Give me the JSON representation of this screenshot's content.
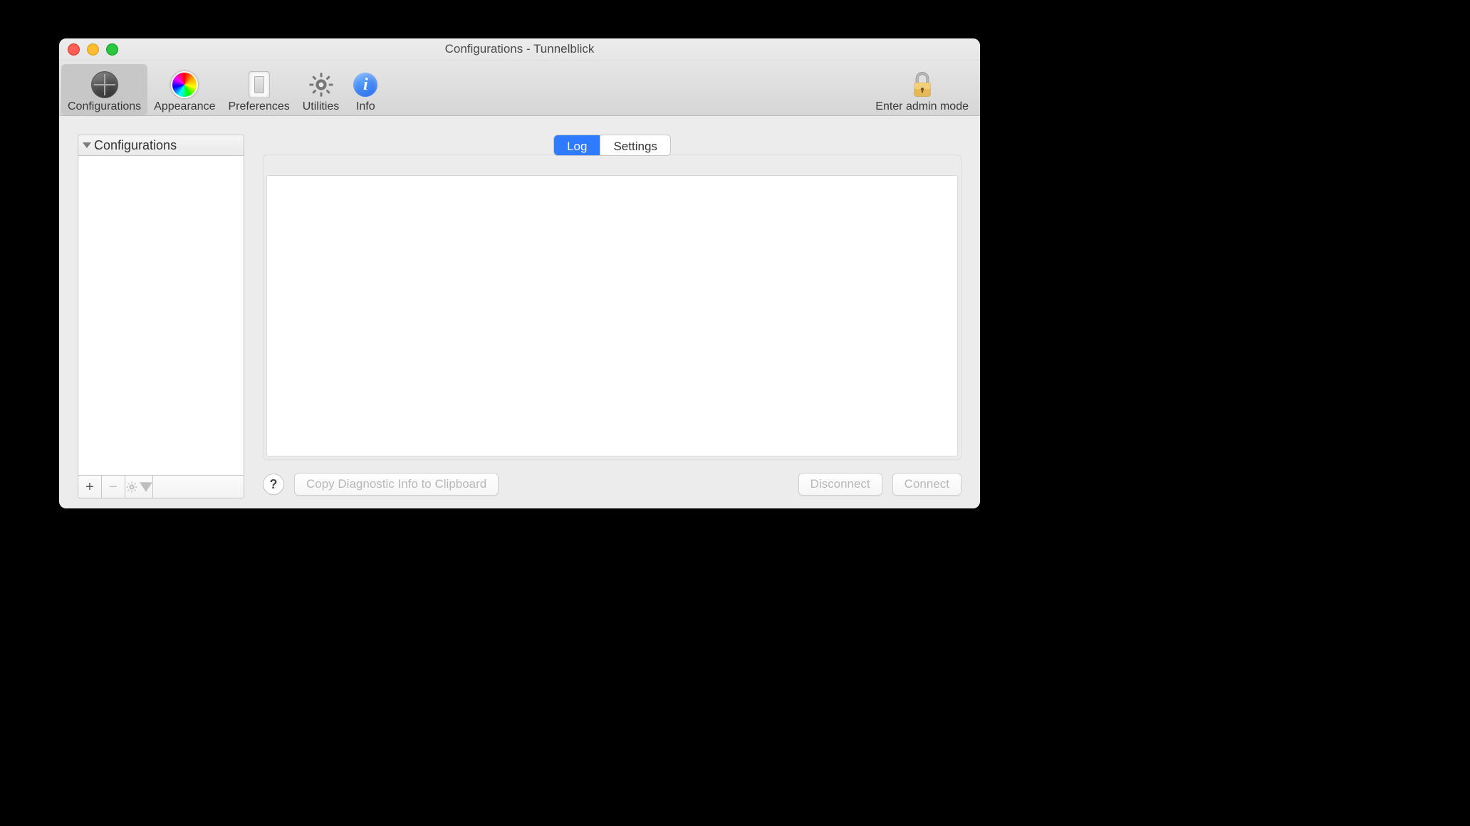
{
  "window": {
    "title": "Configurations - Tunnelblick"
  },
  "toolbar": {
    "items": [
      {
        "label": "Configurations",
        "selected": true
      },
      {
        "label": "Appearance",
        "selected": false
      },
      {
        "label": "Preferences",
        "selected": false
      },
      {
        "label": "Utilities",
        "selected": false
      },
      {
        "label": "Info",
        "selected": false
      }
    ],
    "admin_label": "Enter admin mode"
  },
  "sidebar": {
    "header": "Configurations",
    "items": []
  },
  "segmented": {
    "tabs": [
      {
        "label": "Log",
        "active": true
      },
      {
        "label": "Settings",
        "active": false
      }
    ]
  },
  "log": {
    "content": ""
  },
  "buttons": {
    "help": "?",
    "copy_diag": "Copy Diagnostic Info to Clipboard",
    "disconnect": "Disconnect",
    "connect": "Connect"
  }
}
